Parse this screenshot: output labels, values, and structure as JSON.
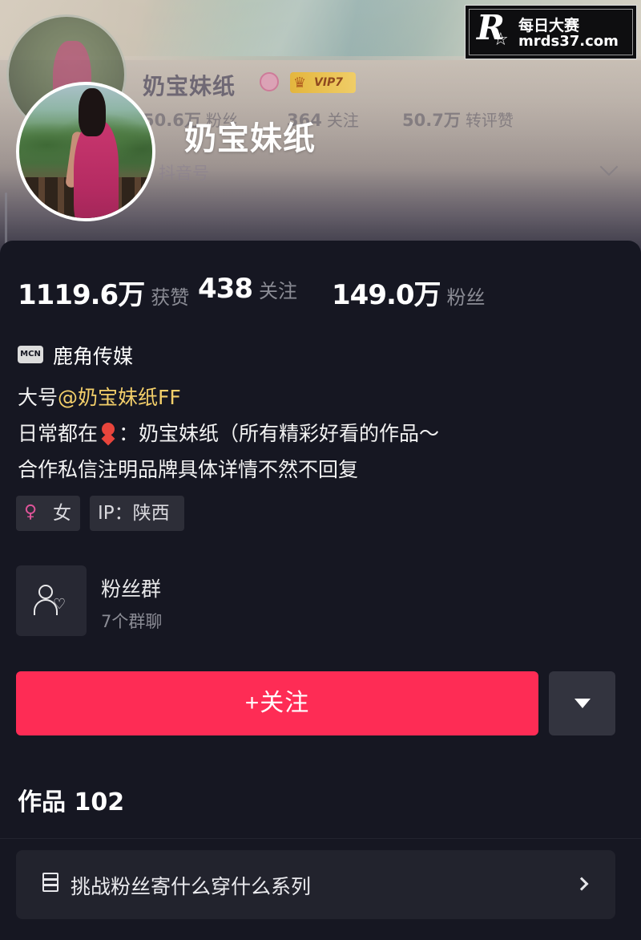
{
  "watermark": {
    "logo": "R",
    "name": "每日大赛",
    "url": "mrds37.com"
  },
  "background_header": {
    "name": "奶宝妹纸",
    "vip_badge": "VIP7",
    "stats": [
      {
        "value": "50.6万",
        "label": "粉丝"
      },
      {
        "value": "364",
        "label": "关注"
      },
      {
        "value": "50.7万",
        "label": "转评赞"
      }
    ],
    "id_label": "抖音号"
  },
  "profile": {
    "name": "奶宝妹纸"
  },
  "stats": [
    {
      "value": "1119.6万",
      "label": "获赞"
    },
    {
      "value": "438",
      "label": "关注"
    },
    {
      "value": "149.0万",
      "label": "粉丝"
    }
  ],
  "mcn": {
    "icon_text": "MCN",
    "name": "鹿角传媒"
  },
  "bio": {
    "line1_prefix": "大号",
    "line1_mention": "@奶宝妹纸FF",
    "line2_prefix": "日常都在",
    "line2_suffix": "：奶宝妹纸（所有精彩好看的作品～",
    "line3": "合作私信注明品牌具体详情不然不回复"
  },
  "tags": {
    "gender": "女",
    "ip": "IP：陕西"
  },
  "fan_group": {
    "title": "粉丝群",
    "subtitle": "7个群聊"
  },
  "actions": {
    "follow": "+关注"
  },
  "works": {
    "title": "作品 102"
  },
  "series": {
    "label": "挑战粉丝寄什么穿什么系列"
  },
  "colors": {
    "background": "#161722",
    "follow_button": "#fe2c55",
    "mention": "#f3cf6a",
    "muted_text": "#8b8c95"
  },
  "icons": [
    "female-icon",
    "person-heart-icon",
    "layers-icon",
    "chevron-right-icon",
    "caret-down-icon",
    "location-pin-icon",
    "crown-icon"
  ]
}
